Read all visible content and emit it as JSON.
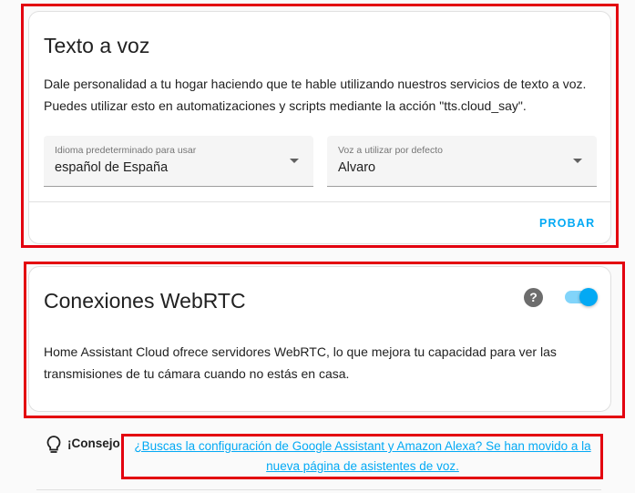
{
  "tts": {
    "title": "Texto a voz",
    "description_line1": "Dale personalidad a tu hogar haciendo que te hable utilizando nuestros servicios de texto a voz.",
    "description_line2": "Puedes utilizar esto en automatizaciones y scripts mediante la acción \"tts.cloud_say\".",
    "language_select": {
      "label": "Idioma predeterminado para usar",
      "value": "español de España"
    },
    "voice_select": {
      "label": "Voz a utilizar por defecto",
      "value": "Alvaro"
    },
    "try_button": "PROBAR"
  },
  "webrtc": {
    "title": "Conexiones WebRTC",
    "help_icon": "help-circle-icon",
    "toggle_state": "on",
    "description_line1": "Home Assistant Cloud ofrece servidores WebRTC, lo que mejora tu capacidad para ver las",
    "description_line2": "transmisiones de tu cámara cuando no estás en casa."
  },
  "tip": {
    "icon": "lightbulb-outline-icon",
    "label": "¡Consejo!",
    "link_line1": "¿Buscas la configuración de Google Assistant y Amazon Alexa? Se han movido a la",
    "link_line2": "nueva página de asistentes de voz."
  },
  "colors": {
    "accent": "#03a9f4",
    "highlight": "#e3000f"
  }
}
